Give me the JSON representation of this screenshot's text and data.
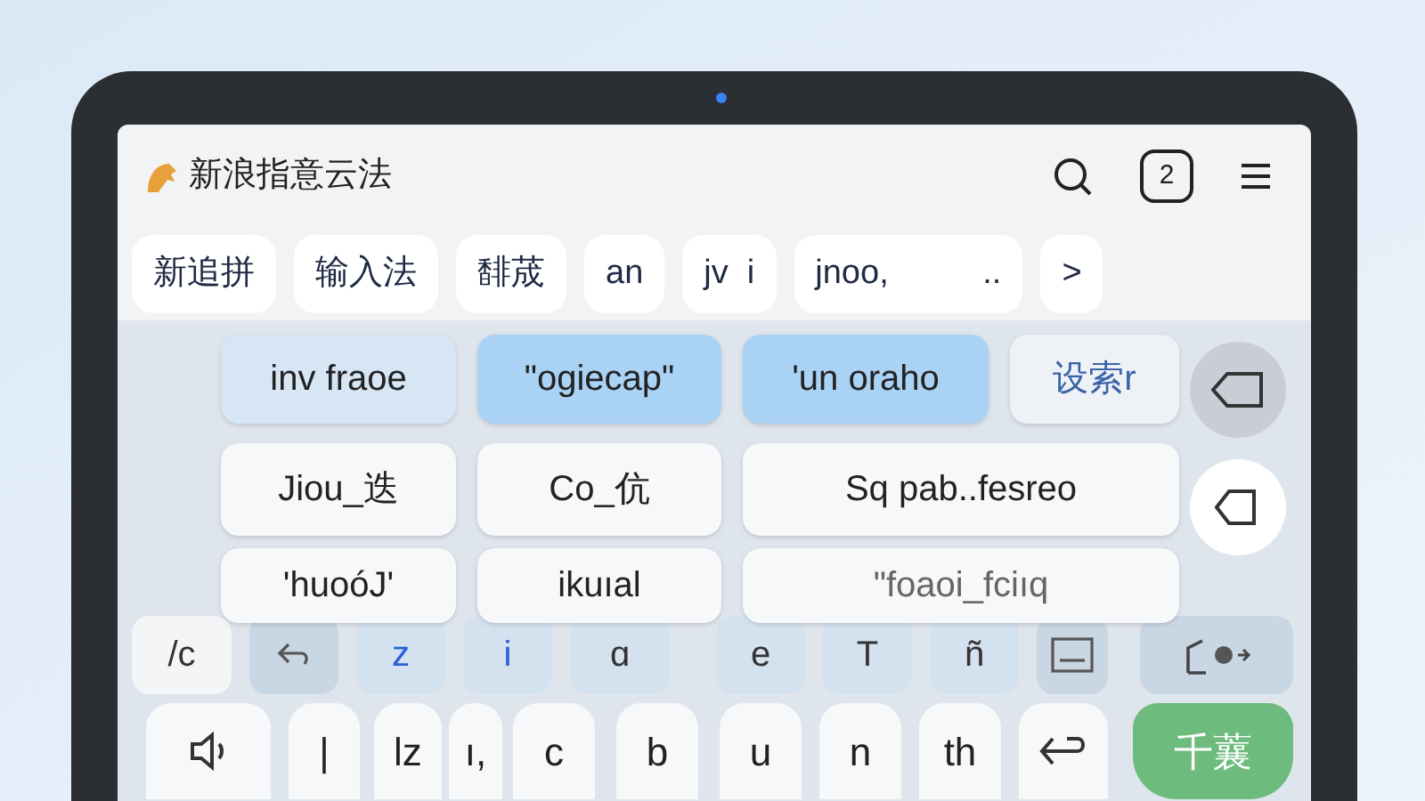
{
  "app": {
    "title": "新浪指意云法",
    "badge": "2"
  },
  "candidates": [
    {
      "text": "新追拼"
    },
    {
      "text": "输入法"
    },
    {
      "text": "馡荿"
    },
    {
      "text": "an"
    },
    {
      "text": "jv  i"
    },
    {
      "text": "jnoo,          .."
    },
    {
      "text": ">"
    }
  ],
  "suggestion_rows": [
    [
      {
        "text": "inv fraoe",
        "selected": false,
        "kind": "tinted"
      },
      {
        "text": "\"ogiecap\"",
        "selected": true,
        "kind": "plain"
      },
      {
        "text": "'un oraho",
        "selected": true,
        "kind": "plain"
      },
      {
        "text": "设索r",
        "selected": false,
        "kind": "hint"
      }
    ],
    [
      {
        "text": "Jiou_迭",
        "selected": false,
        "kind": "plain"
      },
      {
        "text": "Co_伉",
        "selected": false,
        "kind": "plain"
      },
      {
        "text": "Sq pab..fesreo",
        "selected": false,
        "kind": "plain"
      }
    ],
    [
      {
        "text": "'huoóJ'",
        "selected": false,
        "kind": "plain"
      },
      {
        "text": "ikuıal",
        "selected": false,
        "kind": "plain"
      },
      {
        "text": "\"foaoi_fciıq",
        "selected": false,
        "kind": "faded"
      }
    ]
  ],
  "key_row_1": [
    {
      "kind": "text",
      "label": "/c"
    },
    {
      "kind": "undo"
    },
    {
      "kind": "text",
      "label": "z",
      "accent": true
    },
    {
      "kind": "text",
      "label": "i",
      "accent": true
    },
    {
      "kind": "text",
      "label": "ɑ"
    },
    {
      "kind": "text",
      "label": "e"
    },
    {
      "kind": "text",
      "label": "T"
    },
    {
      "kind": "text",
      "label": "ñ"
    },
    {
      "kind": "image"
    },
    {
      "kind": "share"
    }
  ],
  "key_row_2": [
    {
      "kind": "speaker"
    },
    {
      "kind": "text",
      "label": "|"
    },
    {
      "kind": "text",
      "label": "lz"
    },
    {
      "kind": "text",
      "label": "ı,"
    },
    {
      "kind": "text",
      "label": "c"
    },
    {
      "kind": "text",
      "label": "b"
    },
    {
      "kind": "text",
      "label": "u"
    },
    {
      "kind": "text",
      "label": "n"
    },
    {
      "kind": "text",
      "label": "th"
    },
    {
      "kind": "return"
    },
    {
      "kind": "action",
      "label": "千蘘"
    }
  ]
}
